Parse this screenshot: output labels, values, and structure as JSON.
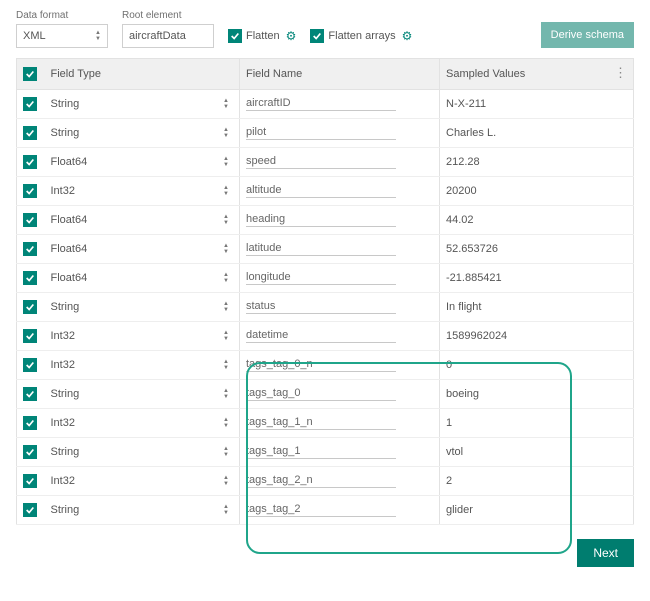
{
  "top": {
    "data_format_label": "Data format",
    "data_format_value": "XML",
    "root_label": "Root element",
    "root_value": "aircraftData",
    "flatten_label": "Flatten",
    "flatten_arrays_label": "Flatten arrays",
    "derive_label": "Derive schema"
  },
  "headers": {
    "type": "Field Type",
    "name": "Field Name",
    "values": "Sampled Values"
  },
  "rows": [
    {
      "type": "String",
      "name": "aircraftID",
      "value": "N-X-211"
    },
    {
      "type": "String",
      "name": "pilot",
      "value": "Charles L."
    },
    {
      "type": "Float64",
      "name": "speed",
      "value": "212.28"
    },
    {
      "type": "Int32",
      "name": "altitude",
      "value": "20200"
    },
    {
      "type": "Float64",
      "name": "heading",
      "value": "44.02"
    },
    {
      "type": "Float64",
      "name": "latitude",
      "value": "52.653726"
    },
    {
      "type": "Float64",
      "name": "longitude",
      "value": "-21.885421"
    },
    {
      "type": "String",
      "name": "status",
      "value": "In flight"
    },
    {
      "type": "Int32",
      "name": "datetime",
      "value": "1589962024"
    },
    {
      "type": "Int32",
      "name": "tags_tag_0_n",
      "value": "0"
    },
    {
      "type": "String",
      "name": "tags_tag_0",
      "value": "boeing"
    },
    {
      "type": "Int32",
      "name": "tags_tag_1_n",
      "value": "1"
    },
    {
      "type": "String",
      "name": "tags_tag_1",
      "value": "vtol"
    },
    {
      "type": "Int32",
      "name": "tags_tag_2_n",
      "value": "2"
    },
    {
      "type": "String",
      "name": "tags_tag_2",
      "value": "glider"
    }
  ],
  "footer": {
    "next_label": "Next"
  }
}
